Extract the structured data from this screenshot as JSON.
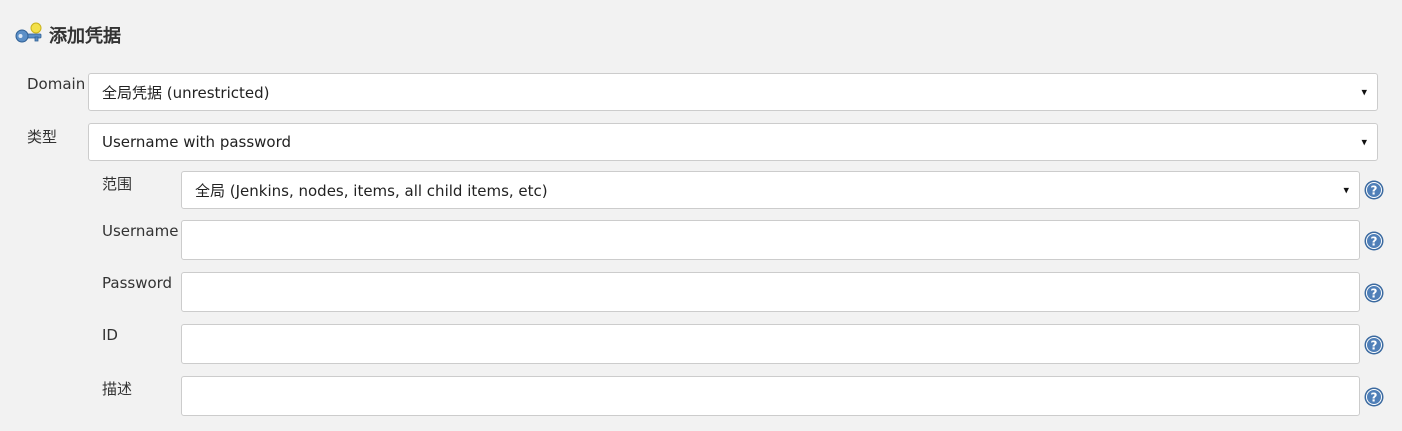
{
  "header": {
    "title": "添加凭据",
    "icon": "credentials-key-icon"
  },
  "form": {
    "domain": {
      "label": "Domain",
      "selected": "全局凭据 (unrestricted)"
    },
    "kind": {
      "label": "类型",
      "selected": "Username with password"
    },
    "scope": {
      "label": "范围",
      "selected": "全局 (Jenkins, nodes, items, all child items, etc)"
    },
    "username": {
      "label": "Username",
      "value": ""
    },
    "password": {
      "label": "Password",
      "value": ""
    },
    "id": {
      "label": "ID",
      "value": ""
    },
    "description": {
      "label": "描述",
      "value": ""
    }
  },
  "icons": {
    "dropdown": "▾",
    "help": "help-icon"
  },
  "colors": {
    "background": "#f2f2f2",
    "help_blue": "#3b6aa0",
    "border": "#cccccc"
  }
}
